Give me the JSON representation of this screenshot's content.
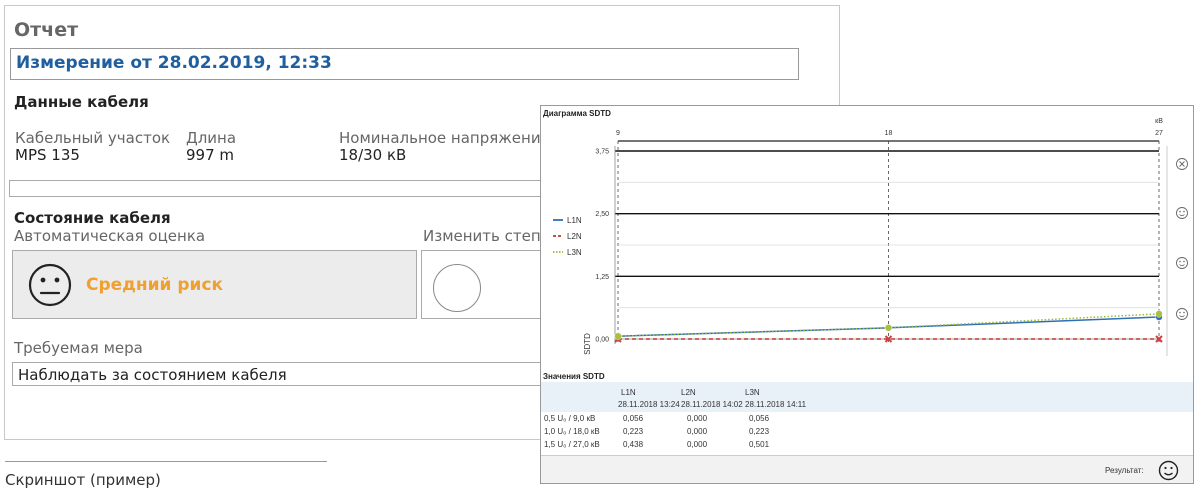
{
  "report": {
    "title": "Отчет",
    "measurement": "Измерение от 28.02.2019, 12:33",
    "cable_data": {
      "title": "Данные кабеля",
      "fields": [
        {
          "label": "Кабельный участок",
          "value": "MPS 135"
        },
        {
          "label": "Длина",
          "value": "997 m"
        },
        {
          "label": "Номинальное напряжени",
          "value": "18/30 кВ"
        }
      ]
    },
    "cable_state": {
      "title": "Состояние кабеля",
      "auto_label": "Автоматическая оценка",
      "change_label": "Изменить степе",
      "risk": "Средний риск",
      "risk_color": "#f0a030"
    },
    "required_measure": {
      "label": "Требуемая мера",
      "value": "Наблюдать за состоянием кабеля"
    }
  },
  "caption": "Скриншот (пример)",
  "sdtd": {
    "title": "Диаграмма SDTD",
    "values_title": "Значения SDTD",
    "result_label": "Результат:",
    "side_icons": [
      "x-circle-icon",
      "smiley-icon",
      "smiley-icon",
      "smiley-icon"
    ],
    "table": {
      "headers": [
        "L1N",
        "L2N",
        "L3N"
      ],
      "dates": [
        "28.11.2018 13:24",
        "28.11.2018 14:02",
        "28.11.2018 14:11"
      ],
      "rows": [
        {
          "label": "0,5 U₀ /  9,0 кВ",
          "values": [
            "0,056",
            "0,000",
            "0,056"
          ]
        },
        {
          "label": "1,0 U₀ / 18,0 кВ",
          "values": [
            "0,223",
            "0,000",
            "0,223"
          ]
        },
        {
          "label": "1,5 U₀ / 27,0 кВ",
          "values": [
            "0,438",
            "0,000",
            "0,501"
          ]
        }
      ]
    }
  },
  "chart_data": {
    "type": "line",
    "title": "Диаграмма SDTD",
    "xlabel": "",
    "x_unit": "кВ",
    "ylabel": "SDTD",
    "x": [
      9,
      18,
      27
    ],
    "x_tick_labels": [
      "9",
      "18",
      "27"
    ],
    "y_tick_labels": [
      "0,00",
      "1,25",
      "2,50",
      "3,75"
    ],
    "y_ticks": [
      0,
      1.25,
      2.5,
      3.75
    ],
    "xlim": [
      9,
      27
    ],
    "ylim": [
      0,
      3.75
    ],
    "grid": true,
    "legend_position": "left",
    "series": [
      {
        "name": "L1N",
        "values": [
          0.056,
          0.223,
          0.438
        ],
        "color": "#2e6fb7",
        "marker_color": "#3a6fc0",
        "dash": "solid"
      },
      {
        "name": "L2N",
        "values": [
          0.0,
          0.0,
          0.0
        ],
        "color": "#c0392b",
        "marker_color": "#d04040",
        "dash": "dashed"
      },
      {
        "name": "L3N",
        "values": [
          0.056,
          0.223,
          0.501
        ],
        "color": "#9ab83a",
        "marker_color": "#a8c040",
        "dash": "dotted"
      }
    ]
  }
}
